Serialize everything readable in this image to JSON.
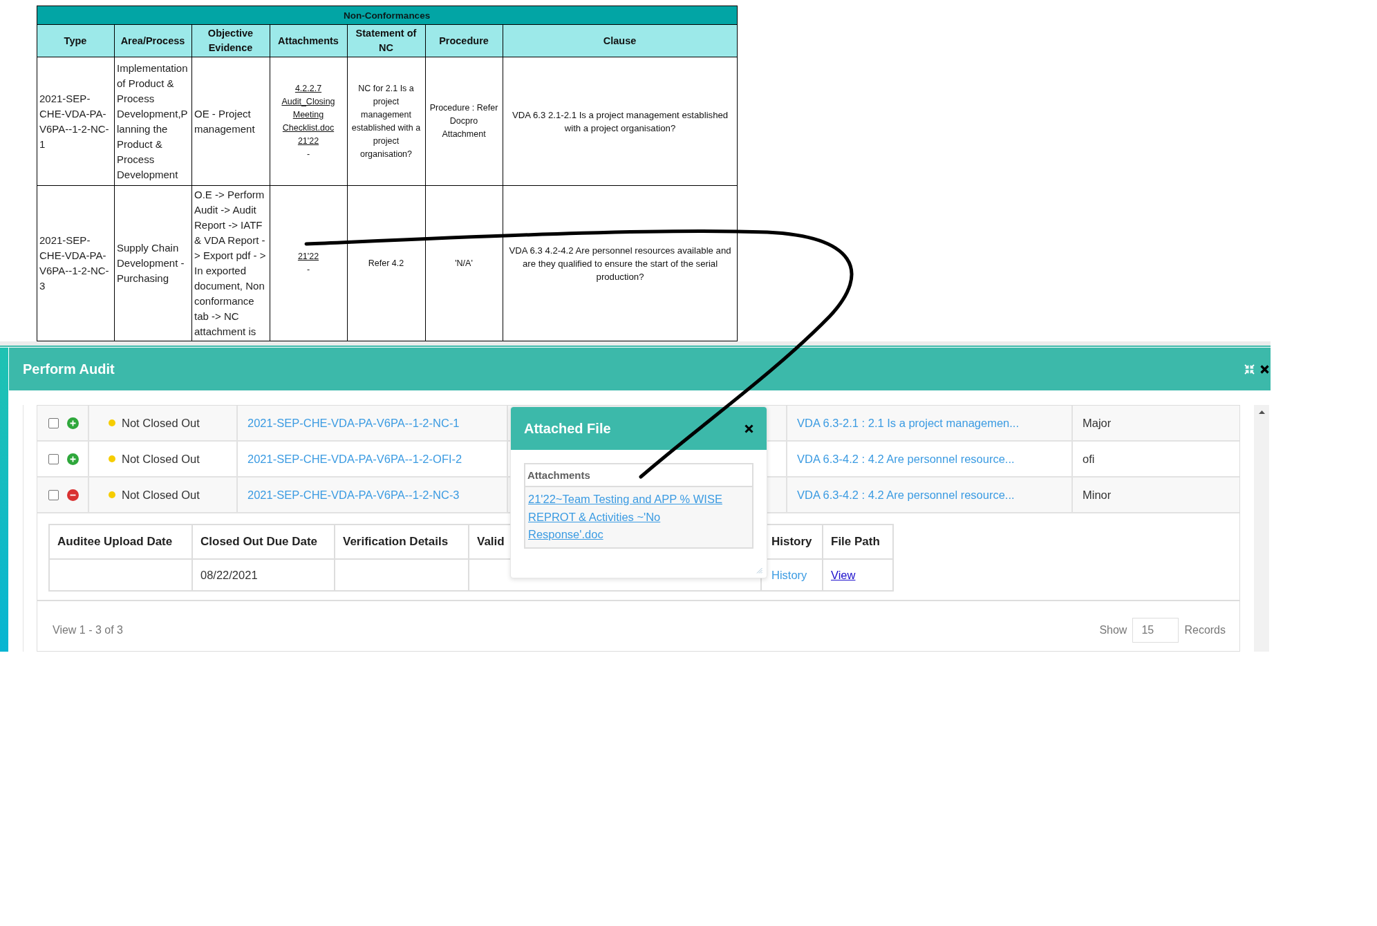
{
  "report": {
    "title": "Non-Conformances",
    "columns": [
      "Type",
      "Area/Process",
      "Objective Evidence",
      "Attachments",
      "Statement of NC",
      "Procedure",
      "Clause"
    ],
    "rows": [
      {
        "type": "2021-SEP-CHE-VDA-PA-V6PA--1-2-NC-1",
        "area_process": "Implementation of Product & Process Development,Planning the Product & Process Development",
        "objective_evidence": "OE - Project management",
        "attachments": [
          "4.2.2.7 Audit_Closing Meeting Checklist.doc",
          "21'22"
        ],
        "attachment_note": "-",
        "statement": "NC for 2.1 Is a project management established with a project organisation?",
        "procedure": "Procedure : Refer Docpro Attachment",
        "clause": "VDA 6.3 2.1-2.1 Is a project management established with a project organisation?"
      },
      {
        "type": "2021-SEP-CHE-VDA-PA-V6PA--1-2-NC-3",
        "area_process": "Supply Chain Development - Purchasing",
        "objective_evidence": "O.E -> Perform Audit -> Audit Report -> IATF & VDA Report - > Export pdf - > In exported document, Non conformance tab -> NC attachment is",
        "attachments": [
          "21'22"
        ],
        "attachment_note": "-",
        "statement": "Refer 4.2",
        "procedure": "'N/A'",
        "clause": "VDA 6.3 4.2-4.2 Are personnel resources available and are they qualified to ensure the start of the serial production?"
      }
    ]
  },
  "dialog": {
    "title": "Perform Audit",
    "rows": [
      {
        "checked": false,
        "expanded": false,
        "status": "Not Closed Out",
        "id": "2021-SEP-CHE-VDA-PA-V6PA--1-2-NC-1",
        "clause": "VDA 6.3-2.1 : 2.1 Is a project managemen...",
        "category": "Major"
      },
      {
        "checked": false,
        "expanded": false,
        "status": "Not Closed Out",
        "id": "2021-SEP-CHE-VDA-PA-V6PA--1-2-OFI-2",
        "clause": "VDA 6.3-4.2 : 4.2 Are personnel resource...",
        "category": "ofi"
      },
      {
        "checked": false,
        "expanded": true,
        "status": "Not Closed Out",
        "id": "2021-SEP-CHE-VDA-PA-V6PA--1-2-NC-3",
        "clause": "VDA 6.3-4.2 : 4.2 Are personnel resource...",
        "category": "Minor",
        "detail": {
          "columns": [
            {
              "label": "Auditee Upload Date"
            },
            {
              "label": "Closed Out Due Date",
              "value": "08/22/2021",
              "kind": "text"
            },
            {
              "label": "Verification Details"
            },
            {
              "label": "Valid"
            },
            {
              "label": "History",
              "value": "History",
              "kind": "action"
            },
            {
              "label": "File Path",
              "value": "View",
              "kind": "file"
            }
          ]
        }
      }
    ],
    "pager": {
      "summary": "View 1 - 3 of 3",
      "show_label": "Show",
      "page_size": "15",
      "records_label": "Records"
    }
  },
  "attachment_popup": {
    "title": "Attached File",
    "list_header": "Attachments",
    "files": [
      "21'22~Team Testing and APP % WISE REPROT & Activities ~'No Response'.doc"
    ]
  }
}
